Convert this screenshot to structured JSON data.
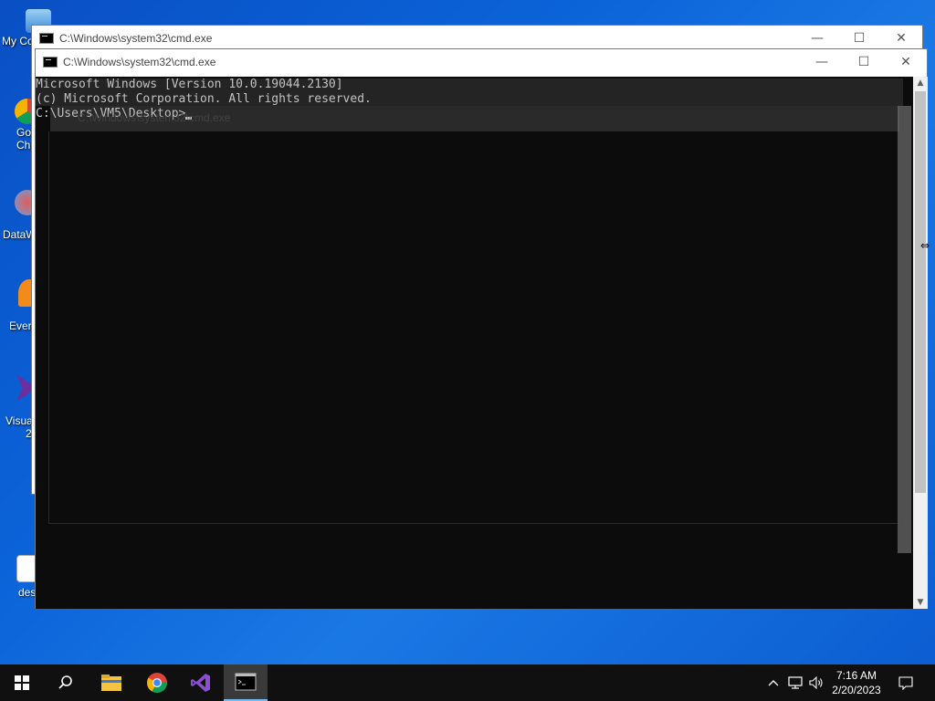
{
  "desktop": {
    "icons": [
      {
        "label": "My Co"
      },
      {
        "label": "Go"
      },
      {
        "label": "Ch"
      },
      {
        "label": "DataW"
      },
      {
        "label": "Ever"
      },
      {
        "label": "Visua"
      },
      {
        "label": "2"
      },
      {
        "label": "des"
      }
    ]
  },
  "windows": {
    "back": {
      "title": "C:\\Windows\\system32\\cmd.exe"
    },
    "front": {
      "title": "C:\\Windows\\system32\\cmd.exe"
    },
    "ghost": {
      "title": "C:\\Windows\\system32\\cmd.exe"
    }
  },
  "console": {
    "line1": "Microsoft Windows [Version 10.0.19044.2130]",
    "line2": "(c) Microsoft Corporation. All rights reserved.",
    "line3": "",
    "prompt": "C:\\Users\\VM5\\Desktop>"
  },
  "titlebar_buttons": {
    "minimize": "—",
    "maximize": "☐",
    "close": "✕"
  },
  "taskbar": {
    "start_icon": "windows-logo-icon",
    "items": [
      "search-icon",
      "file-explorer-icon",
      "chrome-icon",
      "visual-studio-icon",
      "cmd-icon"
    ],
    "tray": {
      "chevron": "^",
      "network": "network-icon",
      "volume": "volume-icon"
    },
    "clock": {
      "time": "7:16 AM",
      "date": "2/20/2023"
    },
    "notification": "notification-icon"
  },
  "colors": {
    "desktop_bg": "#0b63d8",
    "console_bg": "#0c0c0c",
    "console_fg": "#cccccc",
    "taskbar_bg": "#101010",
    "active_indicator": "#76b9ed"
  }
}
